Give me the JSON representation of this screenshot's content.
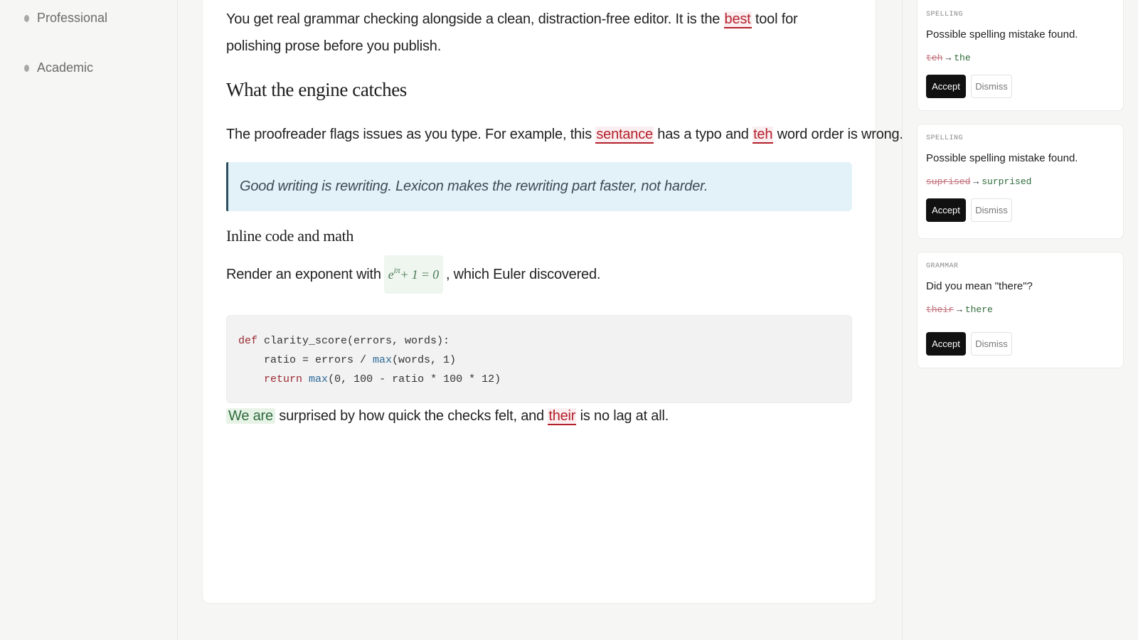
{
  "sidebar": {
    "items": [
      {
        "label": "Professional"
      },
      {
        "label": "Academic"
      }
    ]
  },
  "editor": {
    "p1": {
      "before": "You get real grammar checking alongside a clean, distraction-free editor. It is the ",
      "flag": "best",
      "after": " tool for polishing prose before you publish."
    },
    "heading": "What the engine catches",
    "p2": {
      "a": "The proofreader flags issues as you type. For example, this ",
      "flag1": "sentance",
      "b": " has a typo and ",
      "flag2": "teh",
      "c": " word order is wrong."
    },
    "quote": "Good writing is rewriting. Lexicon makes the rewriting part faster, not harder.",
    "subheading": "Inline code and math",
    "p3": {
      "before": "Render an exponent with",
      "math_base": "e",
      "math_exp": "iπ",
      "math_rest": " + 1 = 0",
      "after": ", which Euler discovered."
    },
    "code": {
      "l1_kw": "def",
      "l1_rest": " clarity_score(errors, words):",
      "l2_a": "    ratio = errors / ",
      "l2_fn": "max",
      "l2_b": "(words, 1)",
      "l3_indent": "    ",
      "l3_kw": "return",
      "l3_sp": " ",
      "l3_fn": "max",
      "l3_b": "(0, 100 - ratio * 100 * 12)"
    },
    "p4": {
      "good": "We are",
      "a": " surprised by how quick the checks felt, and ",
      "flag": "their",
      "b": " is no lag at all."
    }
  },
  "suggestions": [
    {
      "category": "SPELLING",
      "message": "Possible spelling mistake found.",
      "old": "teh",
      "arrow": "→",
      "new": "the",
      "accept": "Accept",
      "dismiss": "Dismiss"
    },
    {
      "category": "SPELLING",
      "message": "Possible spelling mistake found.",
      "old": "suprised",
      "arrow": "→",
      "new": "surprised",
      "accept": "Accept",
      "dismiss": "Dismiss"
    },
    {
      "category": "GRAMMAR",
      "message": "Did you mean \"there\"?",
      "old": "their",
      "arrow": "→",
      "new": "there",
      "accept": "Accept",
      "dismiss": "Dismiss"
    }
  ],
  "colors": {
    "flag": "#b4202a",
    "accept_button": "#111111",
    "quote_bg": "#e3f2f9"
  }
}
